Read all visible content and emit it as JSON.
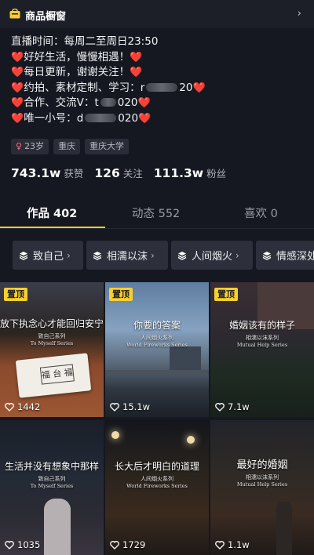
{
  "shop": {
    "label": "商品橱窗",
    "chevron": "›",
    "icon": "shop-icon"
  },
  "bio": {
    "line1": "直播时间：每周二至周日23:50",
    "line2": "好好生活，慢慢相遇！",
    "line3": "每日更新，谢谢关注！",
    "line4_prefix": "约拍、素材定制、学习：",
    "line4_start": "r",
    "line4_end": "20",
    "line5_prefix": "合作、交流V：",
    "line5_start": "t",
    "line5_end": "020",
    "line6_prefix": "唯一小号：",
    "line6_start": "d",
    "line6_end": "020",
    "heart": "❤️"
  },
  "tags": [
    {
      "label": "23岁",
      "gender": "♀"
    },
    {
      "label": "重庆"
    },
    {
      "label": "重庆大学"
    }
  ],
  "stats": [
    {
      "value": "743.1w",
      "label": "获赞"
    },
    {
      "value": "126",
      "label": "关注"
    },
    {
      "value": "111.3w",
      "label": "粉丝"
    }
  ],
  "tabs": [
    {
      "label": "作品 402",
      "active": true
    },
    {
      "label": "动态 552",
      "active": false
    },
    {
      "label": "喜欢 0",
      "active": false
    }
  ],
  "collections": [
    {
      "label": "致自己"
    },
    {
      "label": "相濡以沫"
    },
    {
      "label": "人间烟火"
    },
    {
      "label": "情感深处"
    }
  ],
  "videos": [
    {
      "pinned": true,
      "pin_label": "置顶",
      "title": "放下执念心才能回归安宁",
      "series": "致自己系列",
      "series_en": "To Myself Series",
      "likes": "1442",
      "card_text": "福 台 福"
    },
    {
      "pinned": true,
      "pin_label": "置顶",
      "title": "你要的答案",
      "series": "人间烟火系列",
      "series_en": "World Fireworks Series",
      "likes": "15.1w"
    },
    {
      "pinned": true,
      "pin_label": "置顶",
      "title": "婚姻该有的样子",
      "series": "相濡以沫系列",
      "series_en": "Mutual Help Series",
      "likes": "7.1w"
    },
    {
      "pinned": false,
      "title": "生活并没有想象中那样",
      "series": "致自己系列",
      "series_en": "To Myself Series",
      "likes": "1035"
    },
    {
      "pinned": false,
      "title": "长大后才明白的道理",
      "series": "人间烟火系列",
      "series_en": "World Fireworks Series",
      "likes": "1729"
    },
    {
      "pinned": false,
      "title": "最好的婚姻",
      "series": "相濡以沫系列",
      "series_en": "Mutual Help Series",
      "likes": "1.1w"
    }
  ],
  "colors": {
    "accent": "#f7cc2f",
    "heart": "#ee2d3b",
    "background": "#151721"
  }
}
